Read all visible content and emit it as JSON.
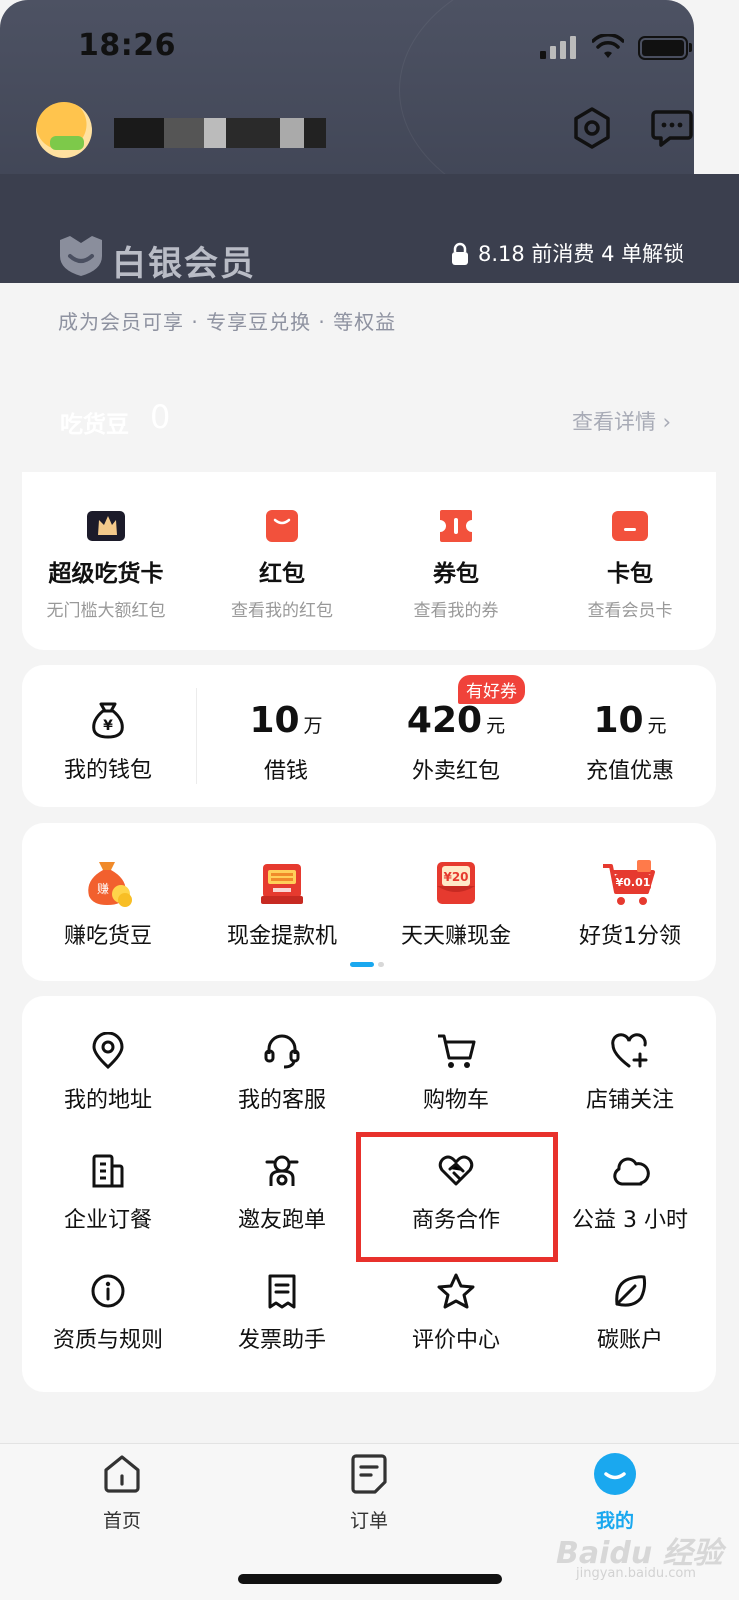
{
  "status": {
    "time": "18:26"
  },
  "member": {
    "title": "白银会员",
    "unlock": "8.18 前消费 4 单解锁",
    "subtitle": "成为会员可享 · 专享豆兑换 · 等权益",
    "beans_label": "吃货豆",
    "beans_value": "0",
    "detail": "查看详情 ›"
  },
  "wallets": [
    {
      "title": "超级吃货卡",
      "sub": "无门槛大额红包",
      "icon": "super-card-icon"
    },
    {
      "title": "红包",
      "sub": "查看我的红包",
      "icon": "red-packet-icon"
    },
    {
      "title": "券包",
      "sub": "查看我的券",
      "icon": "coupon-icon"
    },
    {
      "title": "卡包",
      "sub": "查看会员卡",
      "icon": "card-wallet-icon"
    }
  ],
  "finance": {
    "wallet_label": "我的钱包",
    "badge": "有好券",
    "items": [
      {
        "value": "10",
        "unit": "万",
        "label": "借钱"
      },
      {
        "value": "420",
        "unit": "元",
        "label": "外卖红包"
      },
      {
        "value": "10",
        "unit": "元",
        "label": "充值优惠"
      }
    ]
  },
  "earn": [
    {
      "label": "赚吃货豆",
      "icon": "money-bag-icon",
      "tag": "赚"
    },
    {
      "label": "现金提款机",
      "icon": "atm-icon"
    },
    {
      "label": "天天赚现金",
      "icon": "cash-envelope-icon",
      "tag": "¥20"
    },
    {
      "label": "好货1分领",
      "icon": "shopping-cart-gift-icon",
      "tag": "¥0.01"
    }
  ],
  "tools": [
    {
      "label": "我的地址",
      "icon": "location-pin-icon"
    },
    {
      "label": "我的客服",
      "icon": "headset-icon"
    },
    {
      "label": "购物车",
      "icon": "cart-icon"
    },
    {
      "label": "店铺关注",
      "icon": "heart-plus-icon"
    },
    {
      "label": "企业订餐",
      "icon": "building-icon"
    },
    {
      "label": "邀友跑单",
      "icon": "rider-icon"
    },
    {
      "label": "商务合作",
      "icon": "handshake-icon"
    },
    {
      "label": "公益 3 小时",
      "icon": "cloud-icon"
    },
    {
      "label": "资质与规则",
      "icon": "info-icon"
    },
    {
      "label": "发票助手",
      "icon": "receipt-icon"
    },
    {
      "label": "评价中心",
      "icon": "star-icon"
    },
    {
      "label": "碳账户",
      "icon": "leaf-icon"
    }
  ],
  "nav": [
    {
      "label": "首页",
      "icon": "home-icon"
    },
    {
      "label": "订单",
      "icon": "order-icon"
    },
    {
      "label": "我的",
      "icon": "profile-icon"
    }
  ],
  "watermark": {
    "brand": "Baidu 经验",
    "url": "jingyan.baidu.com"
  },
  "colors": {
    "accent": "#1aa8ef",
    "badge": "#f0423a",
    "highlight": "#e8312c",
    "icon_red": "#f2513c"
  }
}
